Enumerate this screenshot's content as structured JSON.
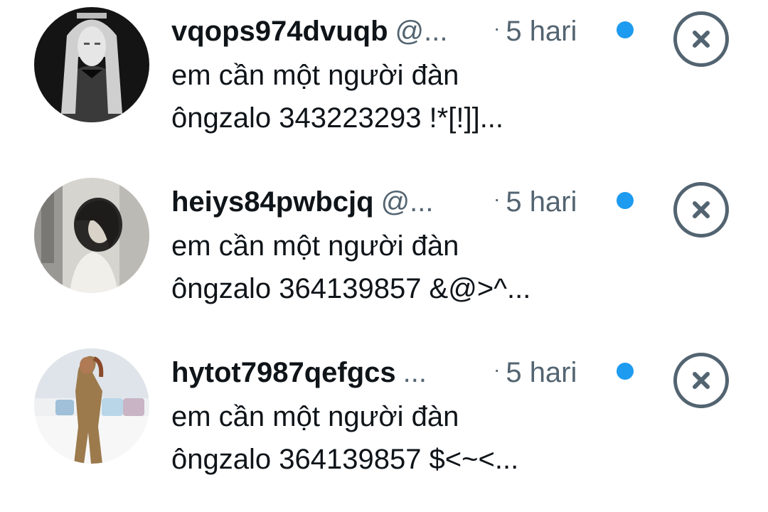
{
  "messages": [
    {
      "display_name": "vqops974dvuqb",
      "handle": "@...",
      "time_separator": "·",
      "time": "5 hari",
      "preview_line1": "em cần một người đàn",
      "preview_line2": "ôngzalo 343223293  !*[!]]...",
      "avatar_icon": "avatar-photo-pale-woman-long-hair-dark-background",
      "unread": true,
      "close_icon": "close-circle-icon"
    },
    {
      "display_name": "heiys84pwbcjq",
      "handle": "@...",
      "time_separator": "·",
      "time": "5 hari",
      "preview_line1": "em cần một người đàn",
      "preview_line2": "ôngzalo 364139857 &@>^...",
      "avatar_icon": "avatar-photo-black-and-white-woman-short-hair",
      "unread": true,
      "close_icon": "close-circle-icon"
    },
    {
      "display_name": "hytot7987qefgcs",
      "handle": "...",
      "time_separator": "·",
      "time": "5 hari",
      "preview_line1": "em cần một người đàn",
      "preview_line2": "ôngzalo 364139857 $<~<...",
      "avatar_icon": "avatar-photo-woman-in-leopard-bodysuit-bedroom",
      "unread": true,
      "close_icon": "close-circle-icon"
    }
  ],
  "colors": {
    "text_primary": "#0f1419",
    "text_secondary": "#536471",
    "unread_dot": "#1d9bf0",
    "background": "#ffffff"
  }
}
